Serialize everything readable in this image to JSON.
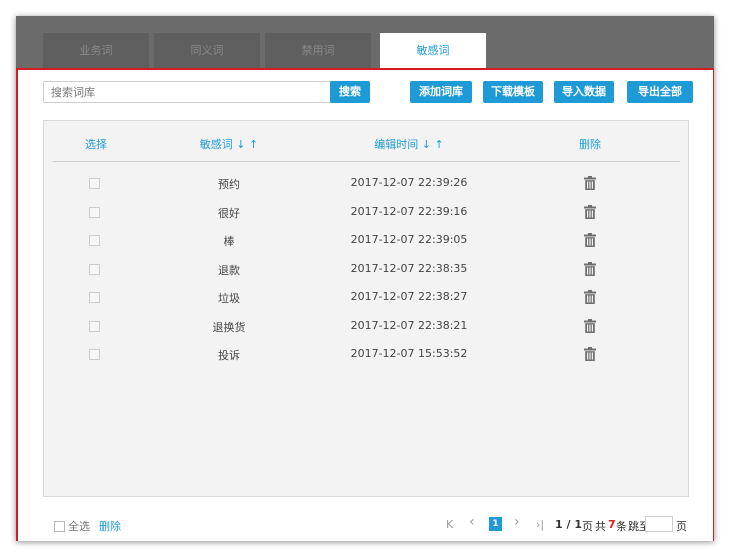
{
  "tabs": [
    {
      "label": "业务词"
    },
    {
      "label": "同义词"
    },
    {
      "label": "禁用词"
    },
    {
      "label": "敏感词"
    }
  ],
  "search": {
    "placeholder": "搜索词库",
    "button_label": "搜索"
  },
  "toolbar": {
    "add_label": "添加词库",
    "download_label": "下载模板",
    "import_label": "导入数据",
    "export_label": "导出全部"
  },
  "table": {
    "headers": {
      "select": "选择",
      "word": "敏感词 ↓ ↑",
      "time": "编辑时间 ↓ ↑",
      "delete": "删除"
    },
    "rows": [
      {
        "word": "预约",
        "time": "2017-12-07 22:39:26"
      },
      {
        "word": "很好",
        "time": "2017-12-07 22:39:16"
      },
      {
        "word": "棒",
        "time": "2017-12-07 22:39:05"
      },
      {
        "word": "退款",
        "time": "2017-12-07 22:38:35"
      },
      {
        "word": "垃圾",
        "time": "2017-12-07 22:38:27"
      },
      {
        "word": "退换货",
        "time": "2017-12-07 22:38:21"
      },
      {
        "word": "投诉",
        "time": "2017-12-07 15:53:52"
      }
    ]
  },
  "footer": {
    "select_all": "全选",
    "delete_label": "删除"
  },
  "pagination": {
    "first": "K",
    "prev": "‹",
    "current": "1",
    "next": "›",
    "last": "›|",
    "page_info": "1 / 1",
    "page_unit": "页",
    "total_prefix": "共",
    "total_count": "7",
    "total_suffix": "条",
    "jump_label": "跳至",
    "jump_suffix": "页"
  },
  "colors": {
    "accent": "#1e9bd7",
    "border_red": "#d51c24",
    "tabbar": "#6b6b6b",
    "count_red": "#e02020"
  },
  "icons": {
    "row_delete": "trash-icon"
  }
}
